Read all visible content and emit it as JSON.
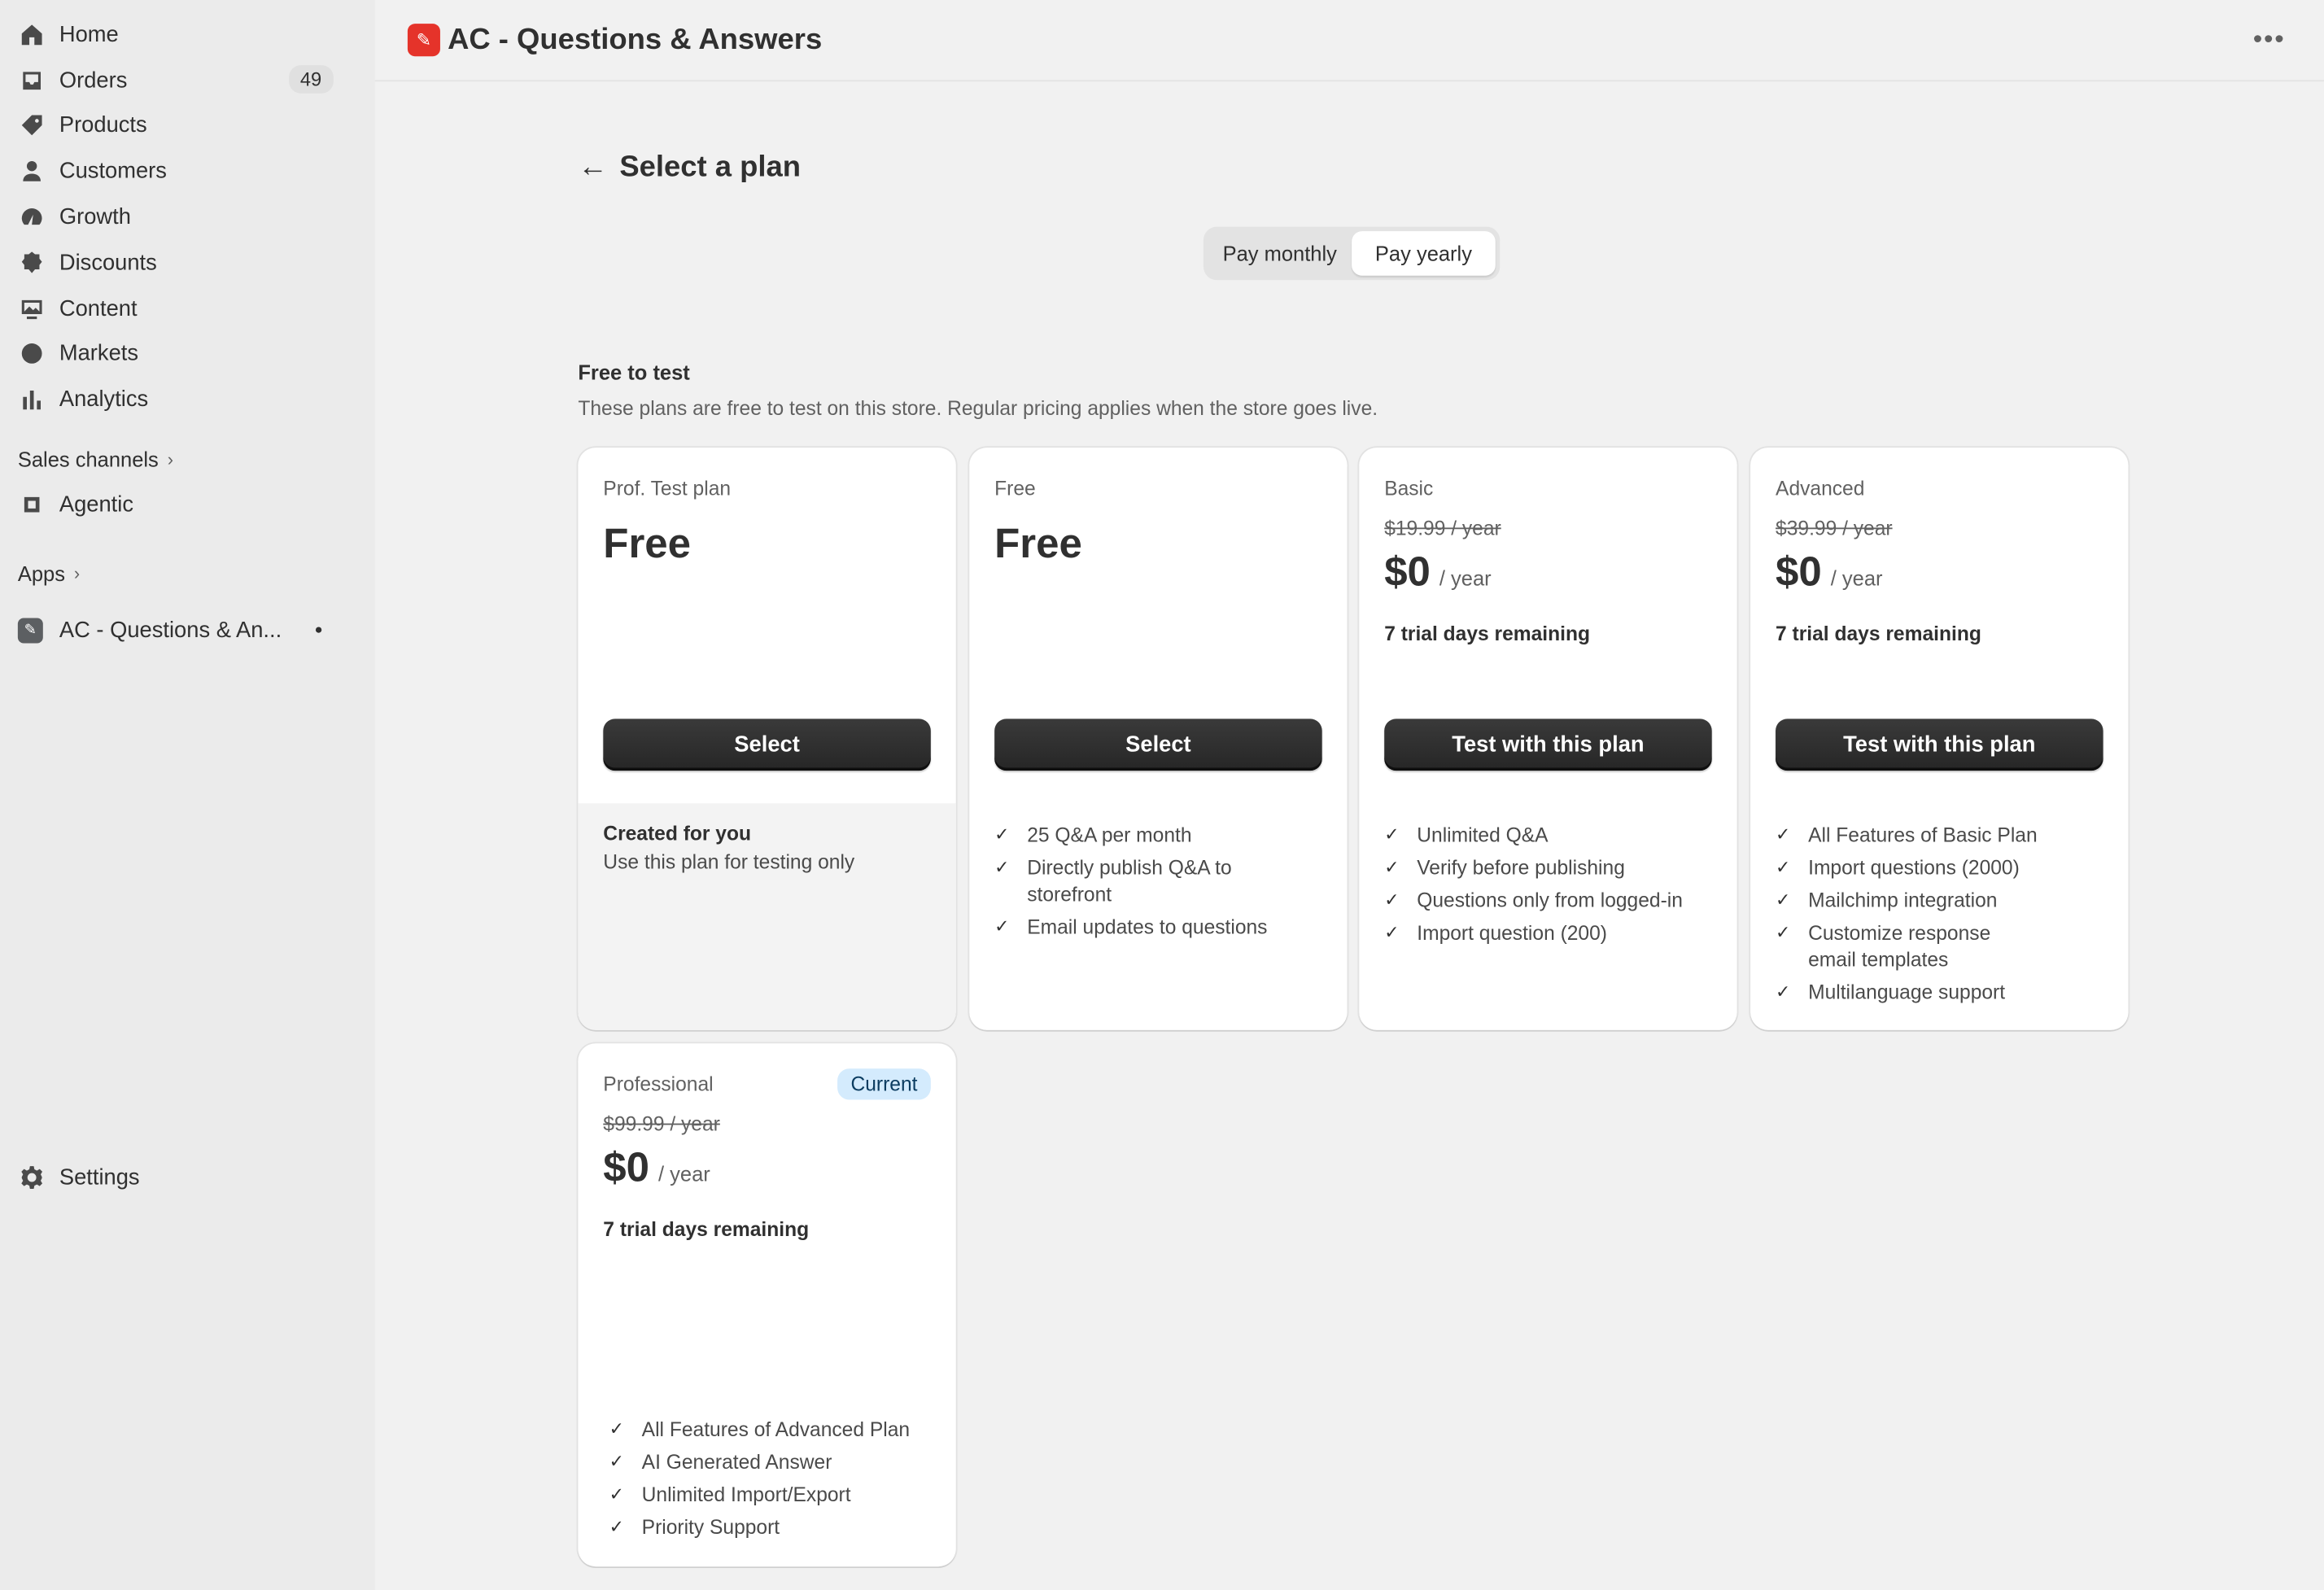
{
  "sidebar": {
    "items": [
      {
        "label": "Home",
        "icon": "home-icon"
      },
      {
        "label": "Orders",
        "icon": "inbox-icon",
        "count": "49"
      },
      {
        "label": "Products",
        "icon": "tag-icon"
      },
      {
        "label": "Customers",
        "icon": "person-icon"
      },
      {
        "label": "Growth",
        "icon": "gauge-icon"
      },
      {
        "label": "Discounts",
        "icon": "discount-icon"
      },
      {
        "label": "Content",
        "icon": "image-icon"
      },
      {
        "label": "Markets",
        "icon": "globe-icon"
      },
      {
        "label": "Analytics",
        "icon": "bar-chart-icon"
      }
    ],
    "sales_channels_label": "Sales channels",
    "agentic_label": "Agentic",
    "apps_label": "Apps",
    "app_item_label": "AC - Questions & An...",
    "settings_label": "Settings"
  },
  "topbar": {
    "title": "AC - Questions & Answers"
  },
  "page": {
    "title": "Select a plan",
    "toggle": {
      "monthly": "Pay monthly",
      "yearly": "Pay yearly",
      "selected": "yearly"
    },
    "section_title": "Free to test",
    "section_subtitle": "These plans are free to test on this store. Regular pricing applies when the store goes live."
  },
  "plans": {
    "prof_test": {
      "name": "Prof. Test plan",
      "price": "Free",
      "button": "Select",
      "created_title": "Created for you",
      "created_sub": "Use this plan for testing only"
    },
    "free": {
      "name": "Free",
      "price": "Free",
      "button": "Select",
      "features": [
        "25 Q&A per month",
        "Directly publish Q&A to storefront",
        "Email updates to questions"
      ]
    },
    "basic": {
      "name": "Basic",
      "original": "$19.99 / year",
      "amount": "$0",
      "per": "/ year",
      "trial": "7 trial days remaining",
      "button": "Test with this plan",
      "features": [
        "Unlimited Q&A",
        "Verify before publishing",
        "Questions only from logged-in",
        "Import question (200)"
      ]
    },
    "advanced": {
      "name": "Advanced",
      "original": "$39.99 / year",
      "amount": "$0",
      "per": "/ year",
      "trial": "7 trial days remaining",
      "button": "Test with this plan",
      "features": [
        "All Features of Basic Plan",
        "Import questions (2000)",
        "Mailchimp integration",
        "Customize response email templates",
        "Multilanguage support"
      ]
    },
    "professional": {
      "name": "Professional",
      "badge": "Current",
      "original": "$99.99 / year",
      "amount": "$0",
      "per": "/ year",
      "trial": "7 trial days remaining",
      "features": [
        "All Features of Advanced Plan",
        "AI Generated Answer",
        "Unlimited Import/Export",
        "Priority Support"
      ]
    }
  },
  "colors": {
    "button": "#303030",
    "current_badge_bg": "#d4ebfd",
    "app_logo": "#e5332a"
  }
}
